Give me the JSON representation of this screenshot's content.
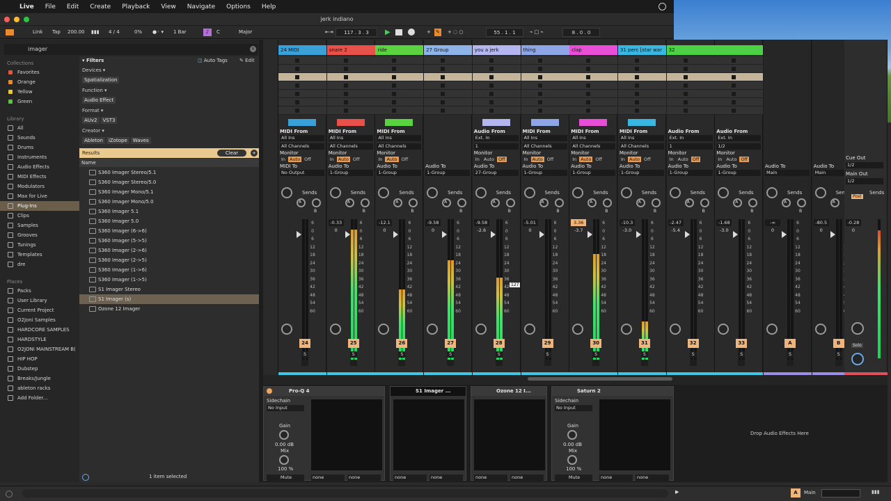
{
  "menubar": {
    "items": [
      "Live",
      "File",
      "Edit",
      "Create",
      "Playback",
      "View",
      "Navigate",
      "Options",
      "Help"
    ]
  },
  "window": {
    "title": "jerk indiano"
  },
  "control": {
    "link": "Link",
    "tap": "Tap",
    "tempo": "200.00",
    "sig": "4 / 4",
    "cpu": "0%",
    "quant": "1 Bar",
    "key": "C",
    "scale": "Major",
    "position": "117 .  3 .  3",
    "loop_start": "55 .  1 .  1",
    "loop_len": "8 .  0 .  0"
  },
  "browser": {
    "search": "imager",
    "collections_label": "Collections",
    "collections": [
      {
        "label": "Favorites",
        "color": "#e05a3a"
      },
      {
        "label": "Orange",
        "color": "#e98b2a"
      },
      {
        "label": "Yellow",
        "color": "#e4cc2f"
      },
      {
        "label": "Green",
        "color": "#5cc24a"
      }
    ],
    "library_label": "Library",
    "library": [
      "All",
      "Sounds",
      "Drums",
      "Instruments",
      "Audio Effects",
      "MIDI Effects",
      "Modulators",
      "Max for Live",
      "Plug-Ins",
      "Clips",
      "Samples",
      "Grooves",
      "Tunings",
      "Templates",
      "dre"
    ],
    "places_label": "Places",
    "places": [
      "Packs",
      "User Library",
      "Current Project",
      "O2Joni Samples",
      "HARDCORE SAMPLES",
      "HARDSTYLE",
      "O2JONI MAINSTREAM B(",
      "HIP HOP",
      "Dubstep",
      "Breaks/Jungle",
      "ableton racks",
      "Add Folder..."
    ],
    "filters": "Filters",
    "auto_tags": "Auto Tags",
    "edit": "Edit",
    "devices_lbl": "Devices ▾",
    "device_tag": "Spatialization",
    "function_lbl": "Function ▾",
    "function_tag": "Audio Effect",
    "format_lbl": "Format ▾",
    "format_tags": [
      "AUv2",
      "VST3"
    ],
    "creator_lbl": "Creator ▾",
    "creator_tags": [
      "Ableton",
      "iZotope",
      "Waves"
    ],
    "results": "Results",
    "clear": "Clear",
    "name_col": "Name",
    "items": [
      "S360 Imager Stereo/5.1",
      "S360 Imager Stereo/5.0",
      "S360 Imager Mono/5.1",
      "S360 Imager Mono/5.0",
      "S360 Imager 5.1",
      "S360 Imager 5.0",
      "S360 Imager (6->6)",
      "S360 Imager (5->5)",
      "S360 Imager (2->6)",
      "S360 Imager (2->5)",
      "S360 Imager (1->6)",
      "S360 Imager (1->5)",
      "S1 Imager Stereo",
      "S1 Imager (s)",
      "Ozone 12 Imager"
    ],
    "status": "1 item selected"
  },
  "tracks": [
    {
      "name": "24 MIDI",
      "color": "#3aa0d8",
      "num": "24",
      "io": "midi",
      "from": "All Ins",
      "ch": "All Channels",
      "to_lbl": "MIDI To",
      "to": "No Output",
      "vol": "",
      "pan": ""
    },
    {
      "name": "snare 2",
      "color": "#e8504a",
      "num": "25",
      "io": "midi",
      "from": "All Ins",
      "ch": "All Channels",
      "to_lbl": "Audio To",
      "to": "1-Group",
      "vol": "-0.33",
      "pan": "0"
    },
    {
      "name": "ride",
      "color": "#5bd23f",
      "num": "26",
      "io": "midi",
      "from": "All Ins",
      "ch": "All Channels",
      "to_lbl": "Audio To",
      "to": "1-Group",
      "vol": "-12.1",
      "pan": "0"
    },
    {
      "name": "27 Group",
      "color": "#8fb5e8",
      "num": "27",
      "io": "group",
      "from": "",
      "ch": "",
      "to_lbl": "Audio To",
      "to": "1-Group",
      "vol": "-9.58",
      "pan": "0"
    },
    {
      "name": "you a jerk",
      "color": "#b4b6f0",
      "num": "28",
      "io": "audio",
      "from": "Ext. In",
      "ch": "1",
      "to_lbl": "Audio To",
      "to": "27-Group",
      "vol": "-9.58",
      "pan": "-2.6"
    },
    {
      "name": "thing",
      "color": "#8fa6e6",
      "num": "29",
      "io": "midi",
      "from": "All Ins",
      "ch": "All Channels",
      "to_lbl": "Audio To",
      "to": "1-Group",
      "vol": "-5.01",
      "pan": "0"
    },
    {
      "name": "clap",
      "color": "#e84fd6",
      "num": "30",
      "io": "midi",
      "from": "All Ins",
      "ch": "All Channels",
      "to_lbl": "Audio To",
      "to": "1-Group",
      "vol": "3.36",
      "pan": "-3.7"
    },
    {
      "name": "31 perc [star war",
      "color": "#3ab7e0",
      "num": "31",
      "io": "midi",
      "from": "All Ins",
      "ch": "All Channels",
      "to_lbl": "Audio To",
      "to": "1-Group",
      "vol": "-10.3",
      "pan": "-3.0"
    },
    {
      "name": "32",
      "color": "#4cd146",
      "num": "32",
      "io": "audio",
      "from": "Ext. In",
      "ch": "1",
      "to_lbl": "Audio To",
      "to": "1-Group",
      "vol": "-2.47",
      "pan": "-5.4"
    },
    {
      "name": "",
      "color": "#4cd146",
      "num": "33",
      "io": "audio",
      "from": "Ext. In",
      "ch": "1/2",
      "to_lbl": "Audio To",
      "to": "1-Group",
      "vol": "-1.68",
      "pan": "-3.0"
    },
    {
      "name": "",
      "color": "#2a2a2a",
      "num": "A",
      "io": "ret",
      "from": "",
      "ch": "",
      "to_lbl": "Audio To",
      "to": "Main",
      "vol": "-∞",
      "pan": "0"
    },
    {
      "name": "",
      "color": "#2a2a2a",
      "num": "B",
      "io": "ret",
      "from": "",
      "ch": "",
      "to_lbl": "Audio To",
      "to": "Main",
      "vol": "-80.5",
      "pan": "0"
    }
  ],
  "master": {
    "cue_lbl": "Cue Out",
    "cue": "1/2",
    "main_lbl": "Main Out",
    "main": "1/2",
    "vol": "-0.28",
    "pan": "0",
    "post": "Post",
    "solo": "Solo"
  },
  "labels": {
    "midi_from": "MIDI From",
    "audio_from": "Audio From",
    "monitor": "Monitor",
    "in": "In",
    "auto": "Auto",
    "off": "Off",
    "sends": "Sends",
    "a": "A",
    "b": "B",
    "s": "S"
  },
  "scale_marks": [
    "6",
    "0",
    "6",
    "12",
    "18",
    "24",
    "30",
    "36",
    "42",
    "48",
    "54",
    "60"
  ],
  "devices": {
    "proq": "Pro-Q 4",
    "s1": "S1 Imager ...",
    "ozone": "Ozone 12 I...",
    "saturn": "Saturn 2",
    "sidechain": "Sidechain",
    "no_input": "No Input",
    "gain": "Gain",
    "gain_val": "0.00 dB",
    "mix": "Mix",
    "mix_val": "100 %",
    "mute": "Mute",
    "none": "none",
    "drop": "Drop Audio Effects Here"
  },
  "status": {
    "main": "Main",
    "a": "A",
    "tooltip": "127"
  }
}
